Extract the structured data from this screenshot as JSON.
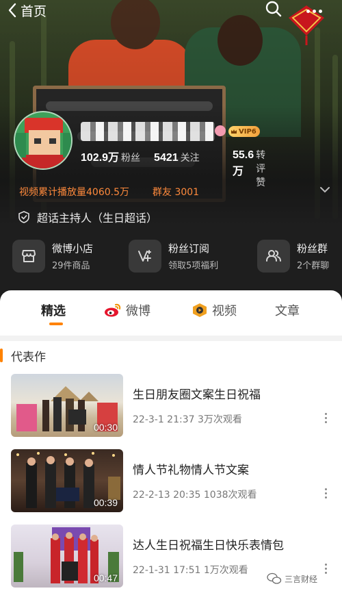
{
  "nav": {
    "back_label": "首页"
  },
  "profile": {
    "vip_label": "VIP6",
    "stats": [
      {
        "value": "102.9万",
        "label": "粉丝"
      },
      {
        "value": "5421",
        "label": "关注"
      },
      {
        "value": "55.6万",
        "label": "转评赞"
      }
    ],
    "play_count_label": "视频累计播放量4060.5万",
    "fan_group_label": "群友 3001",
    "host_label": "超话主持人（生日超话）"
  },
  "services": [
    {
      "title": "微博小店",
      "subtitle": "29件商品",
      "icon": "shop-icon"
    },
    {
      "title": "粉丝订阅",
      "subtitle": "领取5项福利",
      "icon": "subscribe-icon"
    },
    {
      "title": "粉丝群",
      "subtitle": "2个群聊",
      "icon": "group-icon"
    }
  ],
  "tabs": [
    {
      "label": "精选",
      "active": true
    },
    {
      "label": "微博",
      "icon": "weibo-icon"
    },
    {
      "label": "视频",
      "icon": "video-icon"
    },
    {
      "label": "文章"
    }
  ],
  "section": {
    "title": "代表作"
  },
  "videos": [
    {
      "title": "生日朋友圈文案生日祝福",
      "meta": "22-3-1 21:37 3万次观看",
      "duration": "00:30"
    },
    {
      "title": "情人节礼物情人节文案",
      "meta": "22-2-13 20:35 1038次观看",
      "duration": "00:39"
    },
    {
      "title": "达人生日祝福生日快乐表情包",
      "meta": "22-1-31 17:51 1万次观看",
      "duration": "00:47"
    }
  ],
  "watermark": "三言财经",
  "colors": {
    "accent": "#ff8200",
    "play_count": "#ff8a3c",
    "vip_gold": "#f2a03c",
    "dark_bg": "#1f1f1f"
  }
}
